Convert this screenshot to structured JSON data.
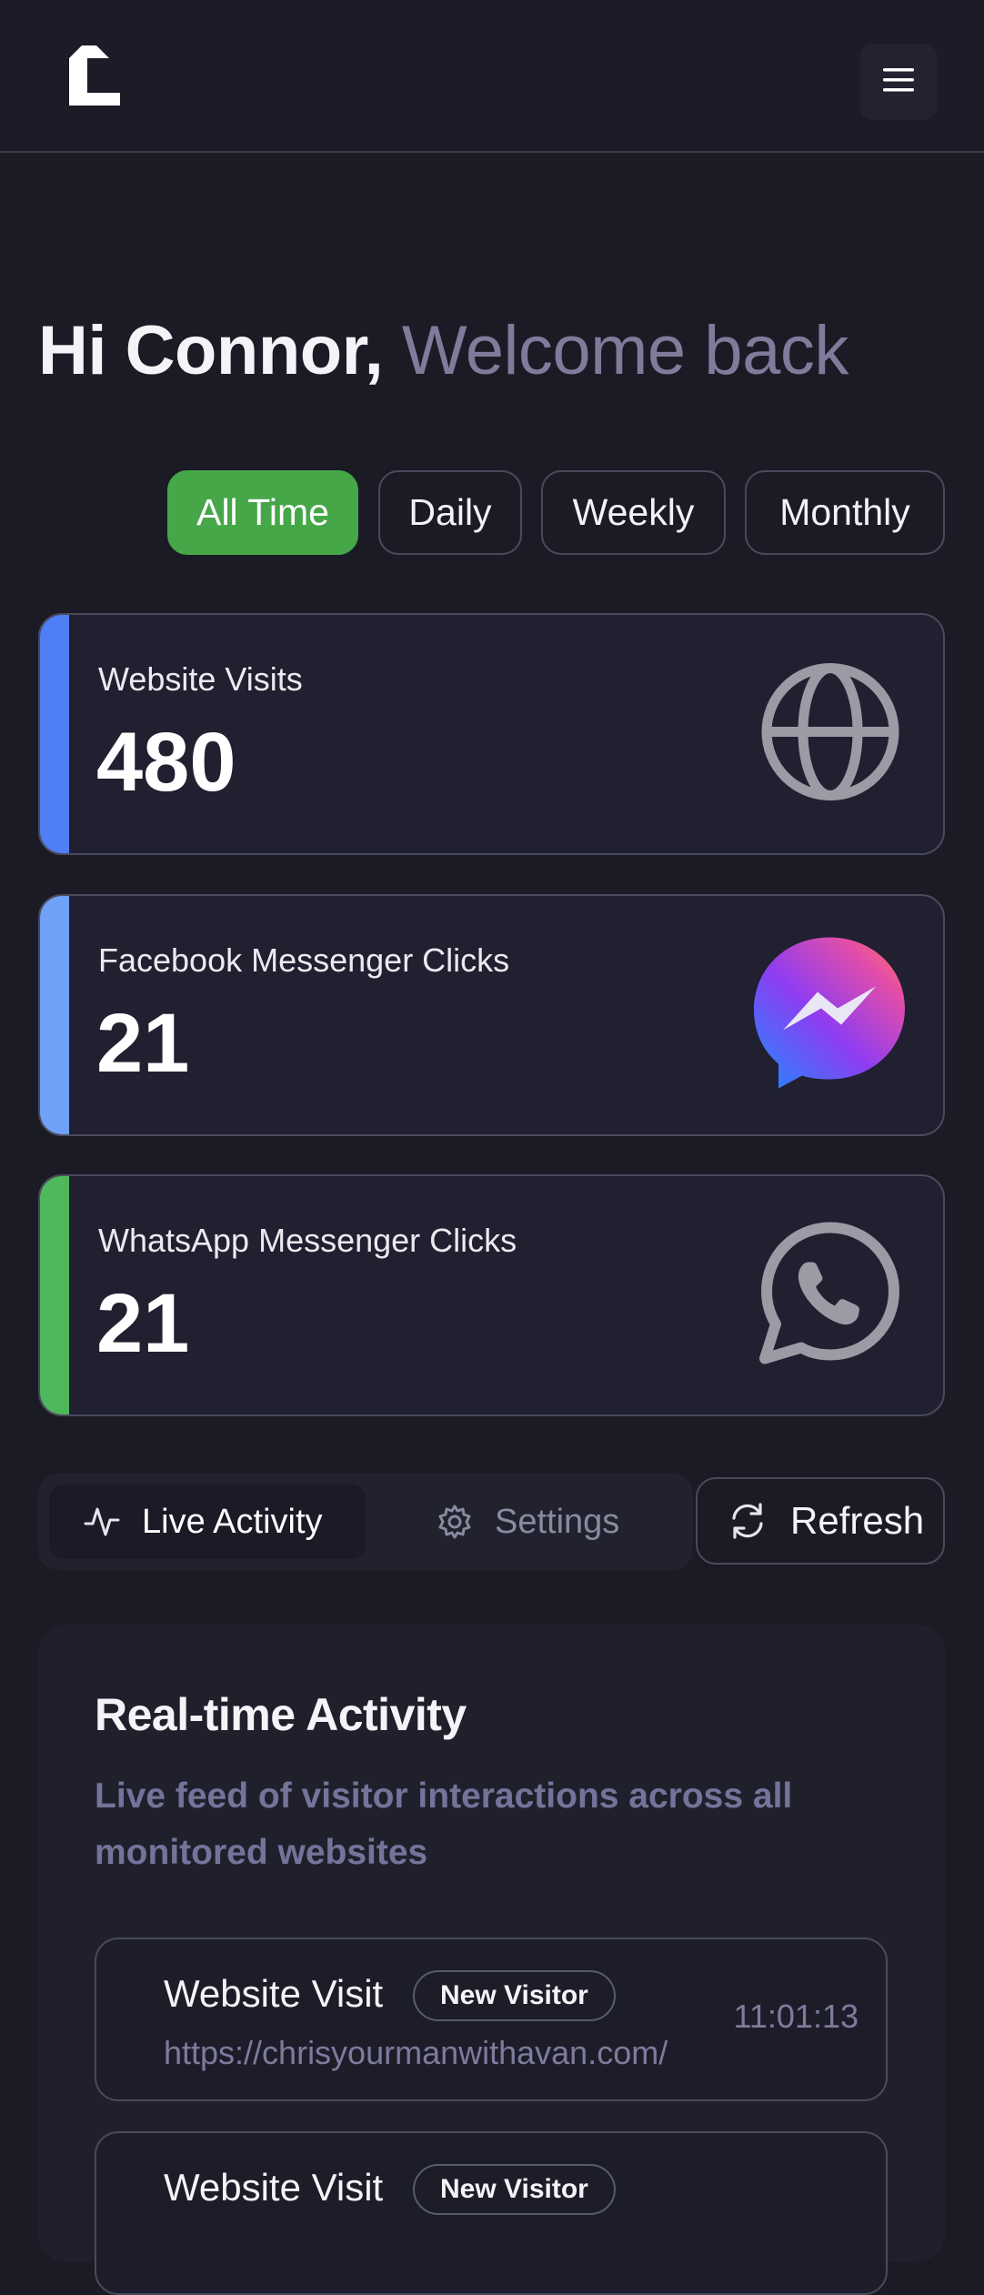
{
  "header": {
    "logo": "brand-logo",
    "menu_icon": "hamburger-menu-icon"
  },
  "greeting": {
    "name": "Hi Connor,",
    "message": "Welcome back"
  },
  "filters": [
    {
      "label": "All Time",
      "active": true
    },
    {
      "label": "Daily",
      "active": false
    },
    {
      "label": "Weekly",
      "active": false
    },
    {
      "label": "Monthly",
      "active": false
    }
  ],
  "stats": [
    {
      "label": "Website Visits",
      "value": "480",
      "icon": "globe-icon",
      "accent": "#4f7ef5"
    },
    {
      "label": "Facebook Messenger Clicks",
      "value": "21",
      "icon": "messenger-icon",
      "accent": "#6ea1f7"
    },
    {
      "label": "WhatsApp Messenger Clicks",
      "value": "21",
      "icon": "whatsapp-icon",
      "accent": "#4fb85c"
    }
  ],
  "tabs": {
    "live_activity": "Live Activity",
    "settings": "Settings",
    "refresh": "Refresh"
  },
  "activity": {
    "title": "Real-time Activity",
    "description": "Live feed of visitor interactions across all monitored websites",
    "items": [
      {
        "title": "Website Visit",
        "badge": "New Visitor",
        "url": "https://chrisyourmanwithavan.com/",
        "time": "11:01:13"
      },
      {
        "title": "Website Visit",
        "badge": "New Visitor",
        "url": "",
        "time": ""
      }
    ]
  },
  "colors": {
    "background": "#1b1b26",
    "active_filter": "#46a748",
    "muted_text": "#7f7b9b"
  }
}
